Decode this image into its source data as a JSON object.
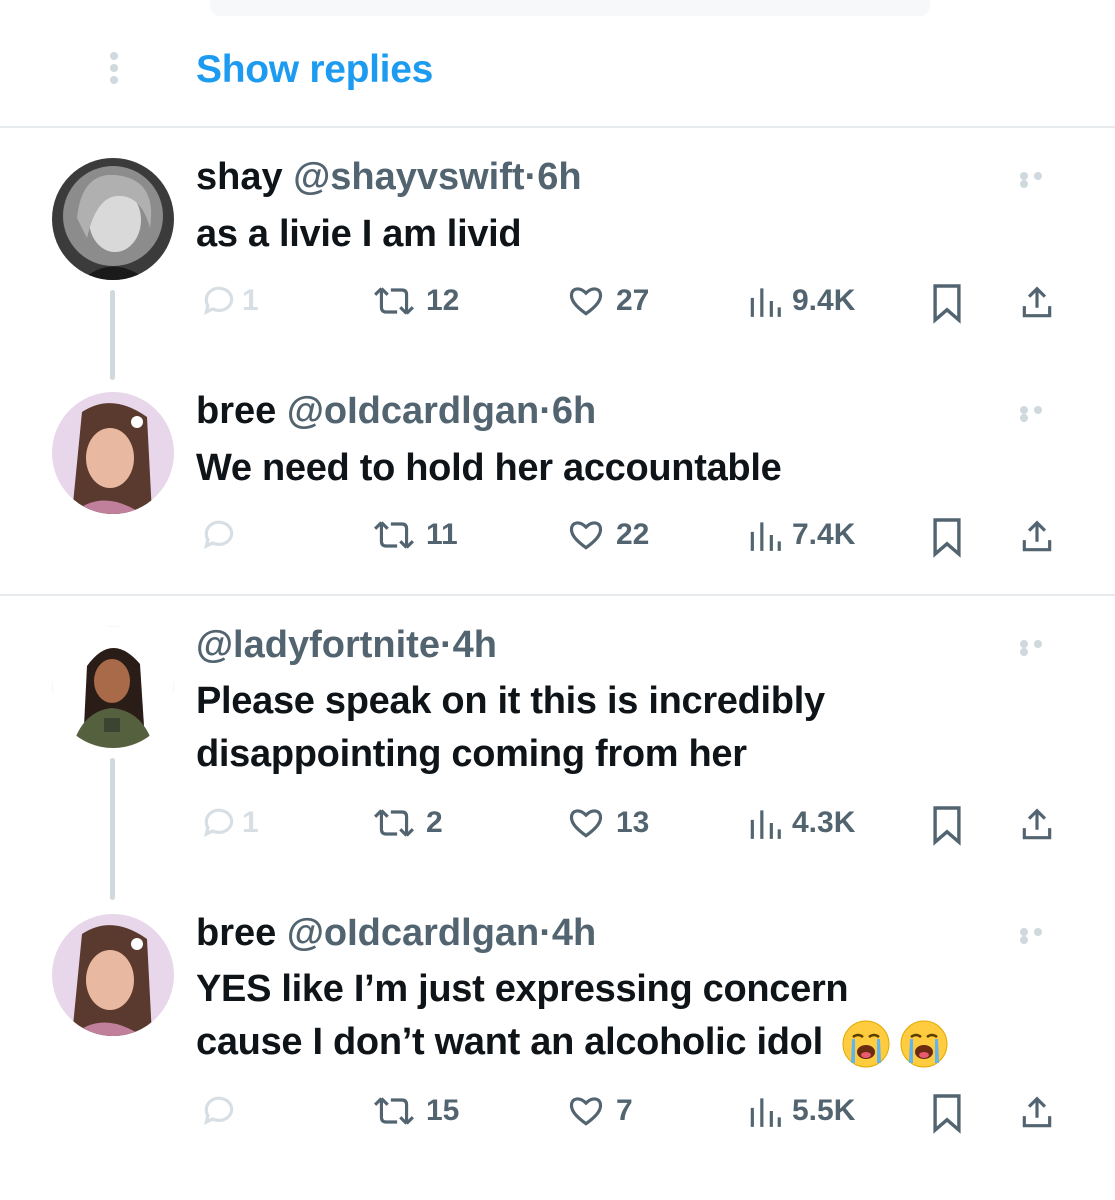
{
  "thread": {
    "show_replies_label": "Show replies"
  },
  "tweets": [
    {
      "name": "shay",
      "handle": "@shayvswift",
      "dot": "·",
      "time": "6h",
      "text": "as a livie I am livid",
      "replies": "1",
      "retweets": "12",
      "likes": "27",
      "views": "9.4K"
    },
    {
      "name": "bree",
      "handle": "@oIdcardlgan",
      "dot": "·",
      "time": "6h",
      "text": "We need to hold her accountable",
      "replies": "",
      "retweets": "11",
      "likes": "22",
      "views": "7.4K"
    },
    {
      "name": "",
      "handle": "@ladyfortnite",
      "dot": "·",
      "time": "4h",
      "text_lines": [
        "Please speak on it this is incredibly",
        "disappointing coming from her"
      ],
      "replies": "1",
      "retweets": "2",
      "likes": "13",
      "views": "4.3K"
    },
    {
      "name": "bree",
      "handle": "@oIdcardlgan",
      "dot": "·",
      "time": "4h",
      "text_lines": [
        "YES like I’m just expressing concern",
        "cause I don’t want an alcoholic idol"
      ],
      "emojis": [
        "loudly-crying-face-emoji",
        "loudly-crying-face-emoji"
      ],
      "replies": "",
      "retweets": "15",
      "likes": "7",
      "views": "5.5K"
    }
  ],
  "colors": {
    "accent": "#1d9bf0",
    "text": "#0f1419",
    "secondary": "#536471",
    "divider": "#e7ebee",
    "thread_line": "#cfd9de"
  }
}
